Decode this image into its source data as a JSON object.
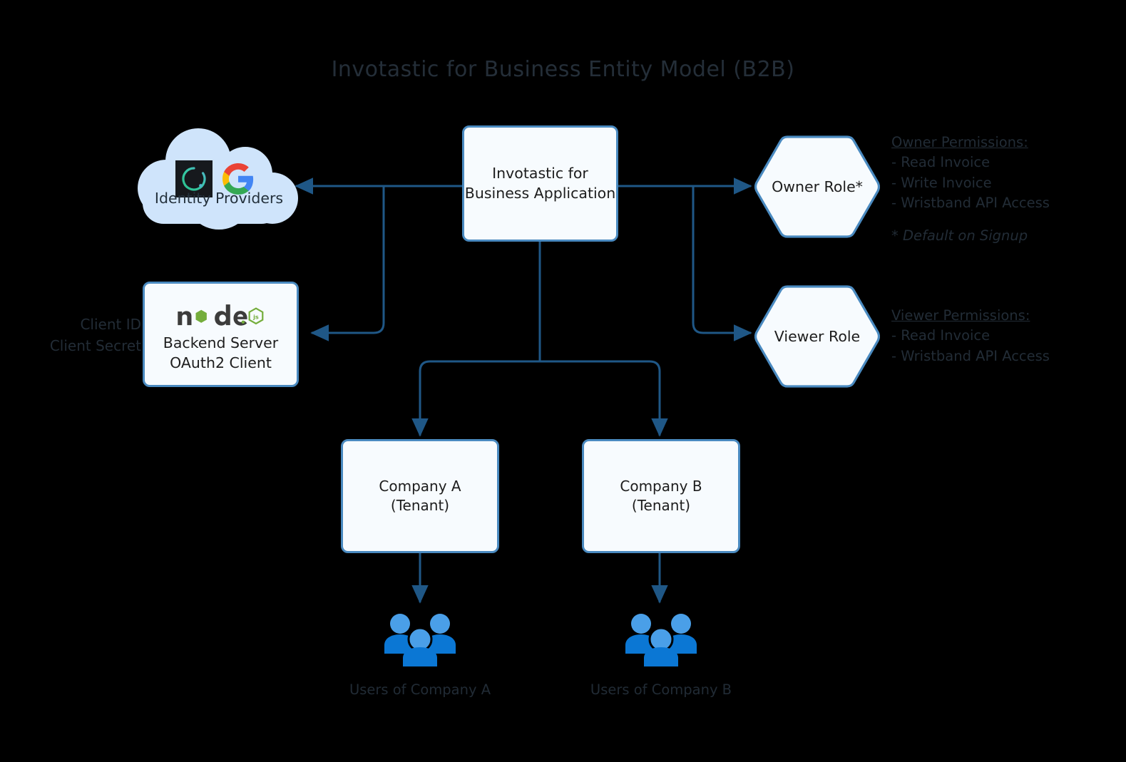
{
  "title": "Invotastic for Business Entity Model (B2B)",
  "colors": {
    "background": "#000000",
    "node_fill": "#f7fbfe",
    "node_border": "#4a8ac0",
    "connector": "#1f5786",
    "cloud_fill": "#cfe4fb",
    "users_icon": "#1b7fd4",
    "text": "#212b35"
  },
  "nodes": {
    "app": {
      "lines": [
        "Invotastic for",
        "Business Application"
      ]
    },
    "identity_providers": {
      "label": "Identity Providers",
      "icons": [
        "cognito-icon",
        "google-icon"
      ]
    },
    "backend": {
      "logo": "nodejs-logo",
      "lines": [
        "Backend Server",
        "OAuth2 Client"
      ]
    },
    "owner_role": {
      "label": "Owner Role*"
    },
    "viewer_role": {
      "label": "Viewer Role"
    },
    "company_a": {
      "lines": [
        "Company A",
        "(Tenant)"
      ]
    },
    "company_b": {
      "lines": [
        "Company B",
        "(Tenant)"
      ]
    }
  },
  "captions": {
    "client_credentials": {
      "lines": [
        "Client ID",
        "Client Secret"
      ]
    },
    "users_a": "Users of Company A",
    "users_b": "Users of Company B"
  },
  "permissions": {
    "owner": {
      "title": "Owner Permissions:",
      "items": [
        "- Read Invoice",
        "- Write Invoice",
        "- Wristband API Access"
      ],
      "note": "* Default on Signup"
    },
    "viewer": {
      "title": "Viewer Permissions:",
      "items": [
        "- Read Invoice",
        "- Wristband API Access"
      ]
    }
  }
}
